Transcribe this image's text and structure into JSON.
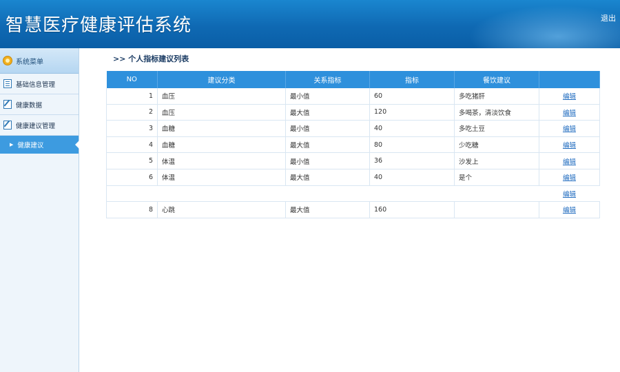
{
  "header": {
    "title": "智慧医疗健康评估系统",
    "logout": "退出"
  },
  "sidebar": {
    "head": "系统菜单",
    "items": [
      {
        "label": "基础信息管理",
        "icon": "list-icon"
      },
      {
        "label": "健康数据",
        "icon": "edit-icon"
      },
      {
        "label": "健康建议管理",
        "icon": "edit-icon"
      }
    ],
    "active_sub": "健康建议"
  },
  "breadcrumb": ">> 个人指标建议列表",
  "table": {
    "columns": [
      "NO",
      "建议分类",
      "关系指标",
      "指标",
      "餐饮建议",
      ""
    ],
    "rows": [
      {
        "no": "1",
        "category": "血压",
        "relation": "最小值",
        "value": "60",
        "advice": "多吃猪肝",
        "action": "编辑"
      },
      {
        "no": "2",
        "category": "血压",
        "relation": "最大值",
        "value": "120",
        "advice": "多喝茶，清淡饮食",
        "action": "编辑"
      },
      {
        "no": "3",
        "category": "血糖",
        "relation": "最小值",
        "value": "40",
        "advice": "多吃土豆",
        "action": "编辑"
      },
      {
        "no": "4",
        "category": "血糖",
        "relation": "最大值",
        "value": "80",
        "advice": "少吃糖",
        "action": "编辑"
      },
      {
        "no": "5",
        "category": "体温",
        "relation": "最小值",
        "value": "36",
        "advice": "沙发上",
        "action": "编辑"
      },
      {
        "no": "6",
        "category": "体温",
        "relation": "最大值",
        "value": "40",
        "advice": "是个",
        "action": "编辑"
      },
      {
        "no": "",
        "category": "",
        "relation": "",
        "value": "",
        "advice": "",
        "action": "编辑",
        "blank": true
      },
      {
        "no": "8",
        "category": "心跳",
        "relation": "最大值",
        "value": "160",
        "advice": "",
        "action": "编辑"
      }
    ]
  },
  "colors": {
    "header_blue": "#0f69b3",
    "table_head": "#2e90dc",
    "active_menu": "#3d9be0",
    "link": "#1f6bbf"
  }
}
